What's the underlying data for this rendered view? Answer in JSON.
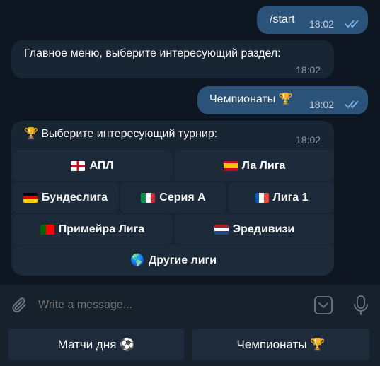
{
  "messages": {
    "start": {
      "text": "/start",
      "time": "18:02"
    },
    "main_menu": {
      "text": "Главное меню, выберите интересующий раздел:",
      "time": "18:02"
    },
    "championships": {
      "text": "Чемпионаты 🏆",
      "time": "18:02"
    },
    "choose_tournament": {
      "text": "🏆 Выберите интересующий турнир:",
      "time": "18:02"
    }
  },
  "inline_keyboard": {
    "epl": "АПЛ",
    "laliga": "Ла Лига",
    "bundesliga": "Бундеслига",
    "seriea": "Серия А",
    "ligue1": "Лига 1",
    "primeira": "Примейра Лига",
    "eredivisie": "Эредивизи",
    "other": "Другие лиги",
    "other_icon": "🌎"
  },
  "composer": {
    "placeholder": "Write a message..."
  },
  "reply_keyboard": {
    "matches": "Матчи дня ⚽",
    "championships": "Чемпионаты 🏆"
  },
  "colors": {
    "background": "#0e1621",
    "outgoing": "#2b5278",
    "incoming": "#182533",
    "button": "#1c2a3a",
    "accent": "#5ea5e8"
  }
}
